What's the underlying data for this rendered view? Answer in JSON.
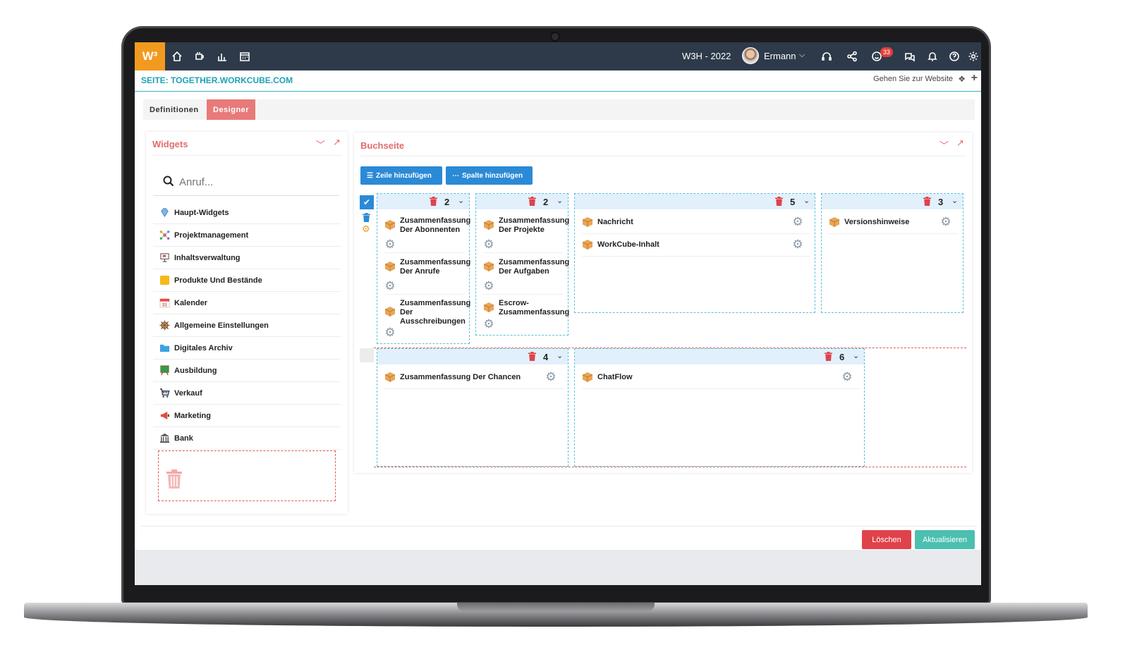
{
  "topbar": {
    "logo": "W³",
    "company": "W3H - 2022",
    "user": "Ermann",
    "notifications_count": "33",
    "icons": [
      "home-icon",
      "coffee-icon",
      "chart-icon",
      "calendar-icon",
      "headset-icon",
      "share-icon",
      "smiley-icon",
      "chat-icon",
      "bell-icon",
      "help-icon",
      "gear-icon"
    ]
  },
  "page": {
    "title": "SEITE: TOGETHER.WORKCUBE.COM",
    "goto_site": "Gehen Sie zur Website"
  },
  "tabs": [
    {
      "label": "Definitionen",
      "active": false
    },
    {
      "label": "Designer",
      "active": true
    }
  ],
  "widgets_panel": {
    "title": "Widgets",
    "search_placeholder": "Anruf...",
    "items": [
      {
        "label": "Haupt-Widgets",
        "icon": "diamond-icon",
        "color": "#6fa8dc"
      },
      {
        "label": "Projektmanagement",
        "icon": "network-icon",
        "color": "#e74c3c"
      },
      {
        "label": "Inhaltsverwaltung",
        "icon": "presentation-icon",
        "color": "#555555"
      },
      {
        "label": "Produkte Und Bestände",
        "icon": "sticky-note-icon",
        "color": "#f5b800"
      },
      {
        "label": "Kalender",
        "icon": "calendar-icon",
        "color": "#e74c3c"
      },
      {
        "label": "Allgemeine Einstellungen",
        "icon": "wheel-icon",
        "color": "#8a5a2b"
      },
      {
        "label": "Digitales Archiv",
        "icon": "folder-icon",
        "color": "#3498db"
      },
      {
        "label": "Ausbildung",
        "icon": "board-icon",
        "color": "#27ae60"
      },
      {
        "label": "Verkauf",
        "icon": "cart-icon",
        "color": "#2c3e50"
      },
      {
        "label": "Marketing",
        "icon": "megaphone-icon",
        "color": "#e74c3c"
      },
      {
        "label": "Bank",
        "icon": "bank-icon",
        "color": "#555555"
      }
    ]
  },
  "book_panel": {
    "title": "Buchseite",
    "add_row": "Zeile hinzufügen",
    "add_column": "Spalte hinzufügen",
    "row1": [
      {
        "num": "2",
        "widgets": [
          [
            "Zusammenfassung",
            "Der Abonnenten"
          ],
          [
            "Zusammenfassung",
            "Der Anrufe"
          ],
          [
            "Zusammenfassung",
            "Der",
            "Ausschreibungen"
          ]
        ]
      },
      {
        "num": "2",
        "widgets": [
          [
            "Zusammenfassung",
            "Der Projekte"
          ],
          [
            "Zusammenfassung",
            "Der Aufgaben"
          ],
          [
            "Escrow-",
            "Zusammenfassung"
          ]
        ]
      },
      {
        "num": "5",
        "widgets": [
          [
            "Nachricht"
          ],
          [
            "WorkCube-Inhalt"
          ]
        ]
      },
      {
        "num": "3",
        "widgets": [
          [
            "Versionshinweise"
          ]
        ]
      }
    ],
    "row2": [
      {
        "num": "4",
        "widgets": [
          [
            "Zusammenfassung Der Chancen"
          ]
        ]
      },
      {
        "num": "6",
        "widgets": [
          [
            "ChatFlow"
          ]
        ]
      }
    ]
  },
  "actions": {
    "delete": "Löschen",
    "update": "Aktualisieren"
  },
  "colors": {
    "accent": "#e46b6b",
    "topbar": "#2e3a4a",
    "primary_button": "#2b8ad6",
    "delete_button": "#e0424a",
    "update_button": "#4bbfb0"
  }
}
